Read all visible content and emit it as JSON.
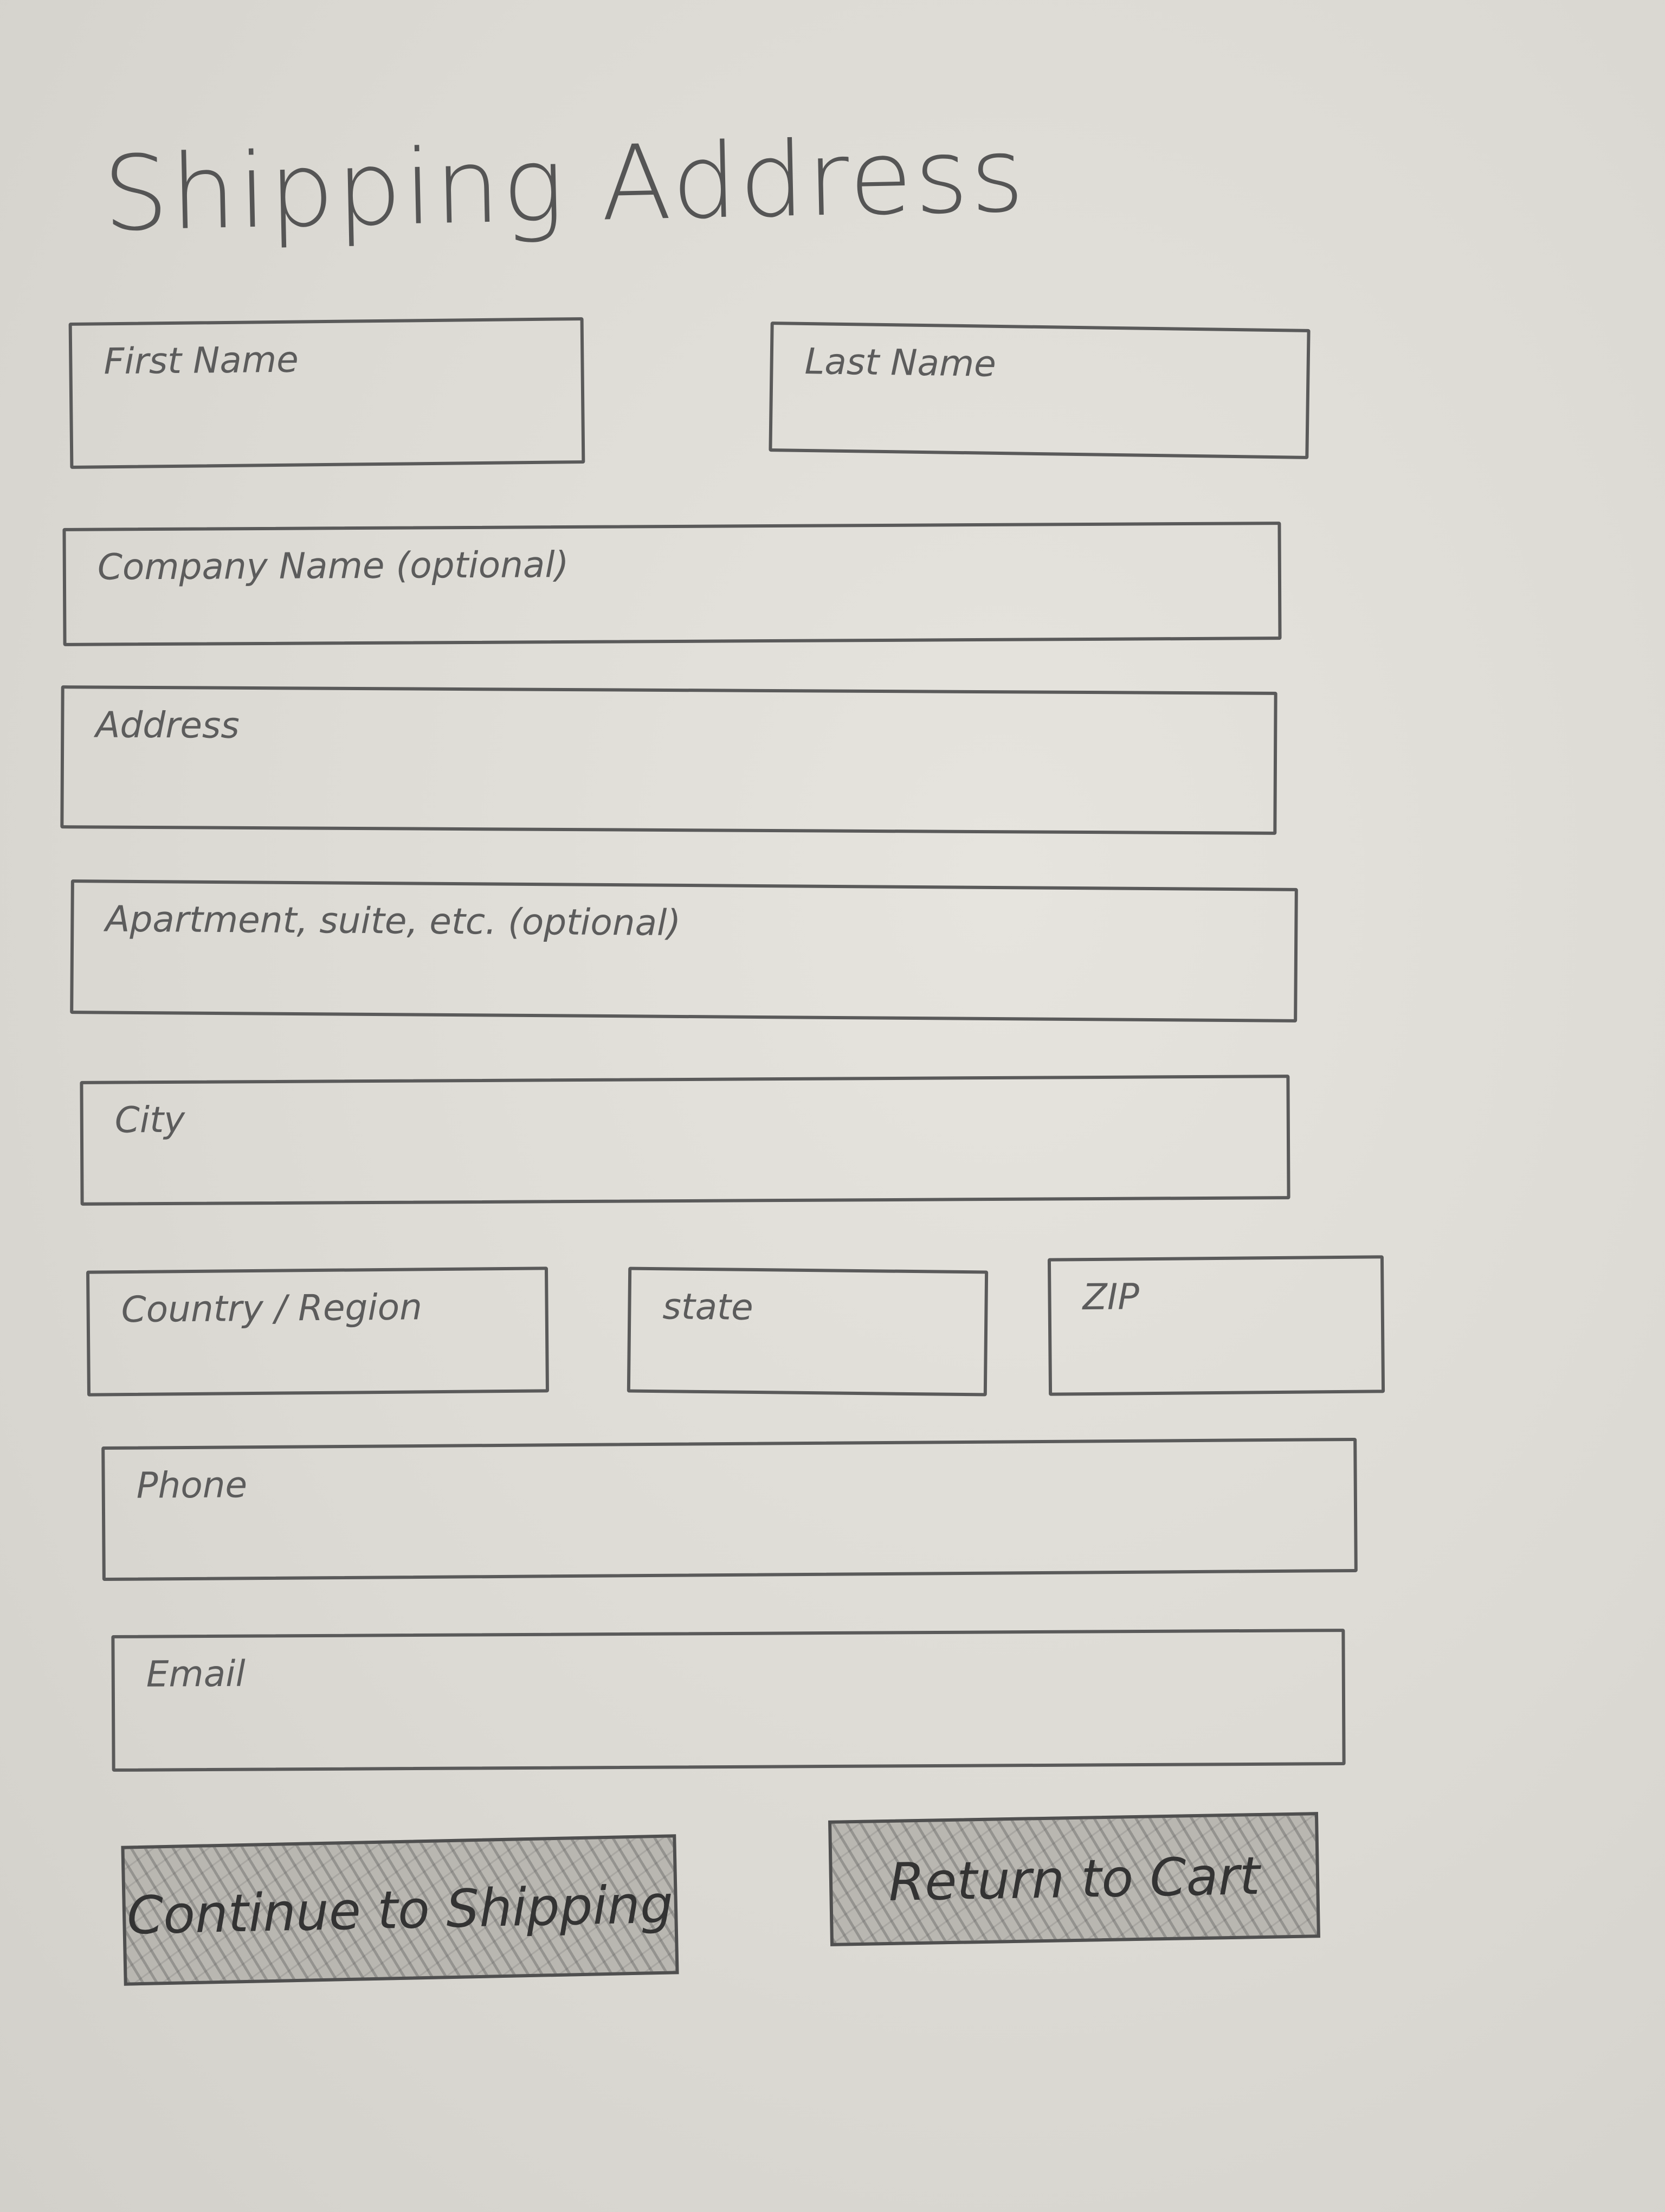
{
  "page": {
    "title": "Shipping Address"
  },
  "form": {
    "first_name": {
      "label": "First Name"
    },
    "last_name": {
      "label": "Last Name"
    },
    "company": {
      "label": "Company Name (optional)"
    },
    "address": {
      "label": "Address"
    },
    "apartment": {
      "label": "Apartment, suite, etc. (optional)"
    },
    "city": {
      "label": "City"
    },
    "country": {
      "label": "Country / Region"
    },
    "state": {
      "label": "state"
    },
    "zip": {
      "label": "ZIP"
    },
    "phone": {
      "label": "Phone"
    },
    "email": {
      "label": "Email"
    }
  },
  "actions": {
    "continue_label": "Continue to Shipping",
    "return_label": "Return to Cart"
  }
}
